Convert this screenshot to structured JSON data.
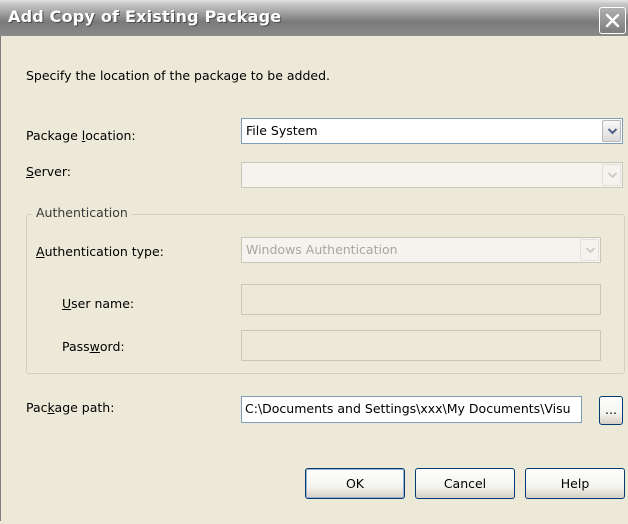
{
  "window": {
    "title": "Add Copy of Existing Package",
    "close_icon": "close-icon"
  },
  "instruction": "Specify the location of the package to be added.",
  "fields": {
    "package_location": {
      "label_pre": "Package ",
      "label_ul": "l",
      "label_post": "ocation:",
      "value": "File System"
    },
    "server": {
      "label_pre": "",
      "label_ul": "S",
      "label_post": "erver:",
      "value": ""
    },
    "authentication_group": "Authentication",
    "auth_type": {
      "label_pre": "",
      "label_ul": "A",
      "label_post": "uthentication type:",
      "value": "Windows Authentication"
    },
    "user_name": {
      "label_pre": "",
      "label_ul": "U",
      "label_post": "ser name:",
      "value": ""
    },
    "password": {
      "label_pre": "Pass",
      "label_ul": "w",
      "label_post": "ord:",
      "value": ""
    },
    "package_path": {
      "label_pre": "Pac",
      "label_ul": "k",
      "label_post": "age path:",
      "value": "C:\\Documents and Settings\\xxx\\My Documents\\Visu"
    }
  },
  "buttons": {
    "browse": "...",
    "ok": "OK",
    "cancel": "Cancel",
    "help": "Help"
  },
  "colors": {
    "dialog_bg": "#ece9d8",
    "title_bar": "#8e8e8e",
    "input_border": "#7f9db9"
  }
}
